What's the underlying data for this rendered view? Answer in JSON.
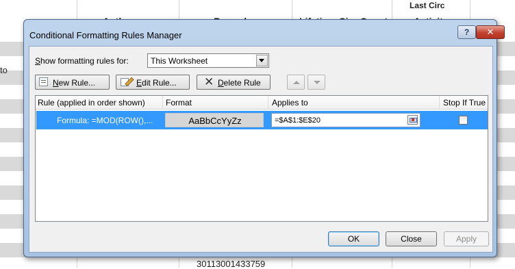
{
  "spreadsheet": {
    "headers": {
      "author": "Author",
      "barcode": "Barcode",
      "lifetime_circ": "Lifetime Circ Count",
      "last_circ_line1": "Last Circ",
      "last_circ_line2": "Activity"
    },
    "left_fragment": "to",
    "bottom_barcode": "30113001433759",
    "stripe_color": "#d9d9d9"
  },
  "dialog": {
    "title": "Conditional Formatting Rules Manager",
    "help_label": "?",
    "close_label": "✕",
    "show_rules_prefix": "S",
    "show_rules_label": "how formatting rules for:",
    "scope_value": "This Worksheet",
    "toolbar": {
      "new_rule_u": "N",
      "new_rule_rest": "ew Rule...",
      "edit_rule_u": "E",
      "edit_rule_rest": "dit Rule...",
      "delete_rule_u": "D",
      "delete_rule_rest": "elete Rule"
    },
    "columns": {
      "rule": "Rule (applied in order shown)",
      "format": "Format",
      "applies_to": "Applies to",
      "stop_if_true": "Stop If True"
    },
    "rules": [
      {
        "rule": "Formula: =MOD(ROW(),...",
        "format_preview": "AaBbCcYyZz",
        "applies_to": "=$A$1:$E$20",
        "stop_if_true": false
      }
    ],
    "buttons": {
      "ok": "OK",
      "close": "Close",
      "apply": "Apply"
    },
    "colors": {
      "selection": "#3399ff",
      "title_bg": "#bfd4ec",
      "close_button": "#c2412f"
    }
  }
}
